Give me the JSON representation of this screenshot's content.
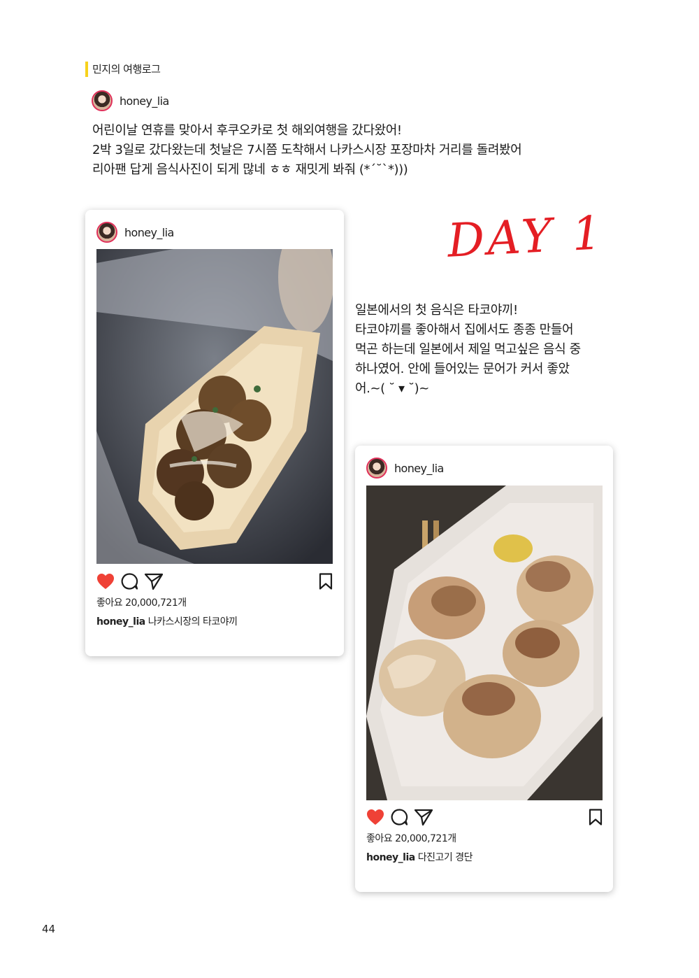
{
  "section_label": "민지의 여행로그",
  "intro": {
    "username": "honey_lia",
    "lines": [
      "어린이날 연휴를 맞아서 후쿠오카로 첫 해외여행을 갔다왔어!",
      "2박 3일로 갔다왔는데 첫날은 7시쯤 도착해서 나카스시장 포장마차 거리를 돌려봤어",
      "리아팬 답게 음식사진이 되게 많네 ㅎㅎ 재밋게 봐줘 (*´˘`*)))"
    ]
  },
  "day_title": "DAY 1",
  "day_text": {
    "lines": [
      "일본에서의 첫 음식은 타코야끼!",
      "타코야끼를 좋아해서 집에서도 종종 만들어",
      "먹곤 하는데 일본에서 제일 먹고싶은 음식 중",
      "하나였어. 안에 들어있는 문어가 커서 좋았",
      "어.~( ˘ ▾ ˘)~"
    ]
  },
  "posts": [
    {
      "username": "honey_lia",
      "likes": "좋아요 20,000,721개",
      "caption_user": "honey_lia",
      "caption_text": "나카스시장의 타코야끼",
      "photo_icon": "takoyaki-photo"
    },
    {
      "username": "honey_lia",
      "likes": "좋아요 20,000,721개",
      "caption_user": "honey_lia",
      "caption_text": "다진고기 경단",
      "photo_icon": "shumai-photo"
    }
  ],
  "page_number": "44",
  "colors": {
    "accent_yellow": "#f7d21c",
    "heart": "#ef4136",
    "day_red": "#e41e24"
  }
}
